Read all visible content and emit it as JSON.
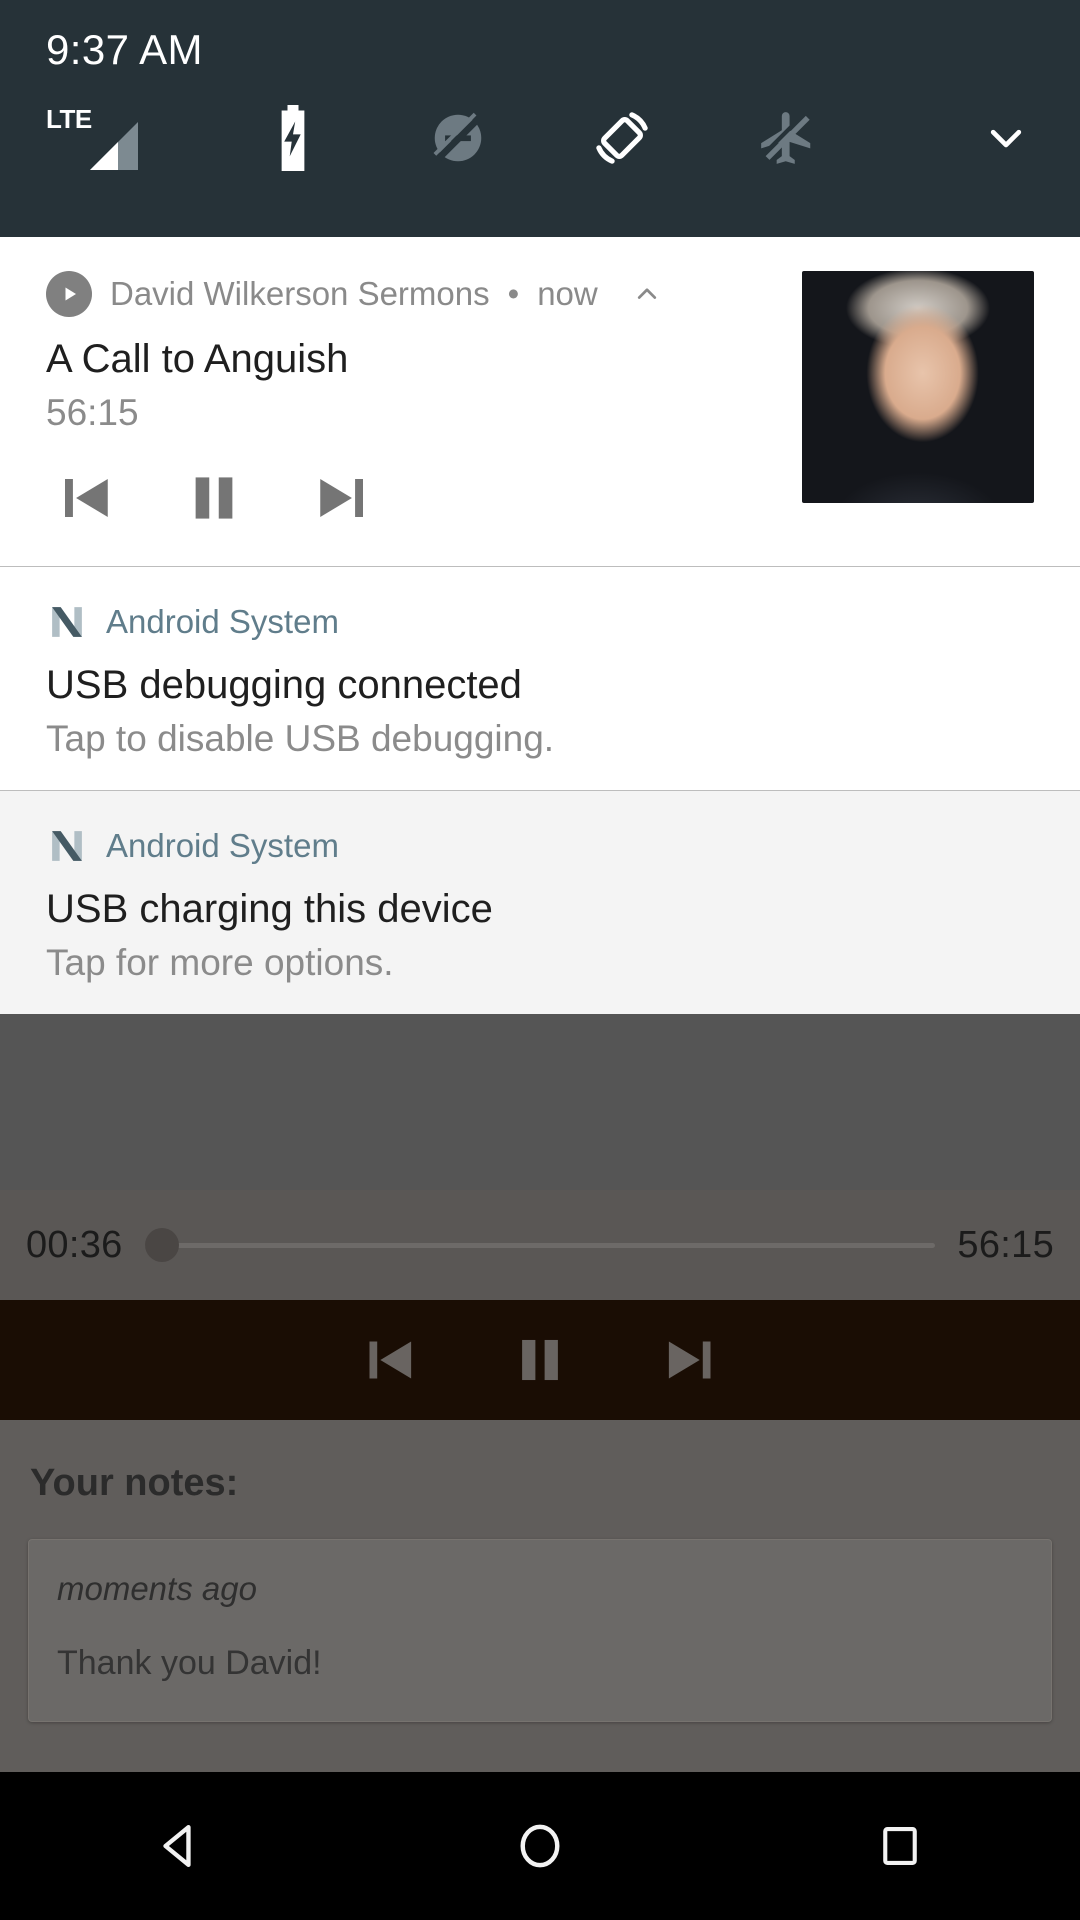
{
  "status_bar": {
    "clock": "9:37 AM",
    "icons": [
      {
        "name": "lte-signal-icon",
        "label": "LTE"
      },
      {
        "name": "battery-charging-icon",
        "label": ""
      },
      {
        "name": "do-not-disturb-off-icon",
        "label": ""
      },
      {
        "name": "auto-rotate-icon",
        "label": ""
      },
      {
        "name": "airplane-mode-off-icon",
        "label": ""
      },
      {
        "name": "chevron-down-icon",
        "label": ""
      }
    ],
    "background_color": "#263238"
  },
  "notifications": [
    {
      "type": "media",
      "app_name": "David Wilkerson Sermons",
      "separator": "•",
      "time": "now",
      "title": "A Call to Anguish",
      "subtitle": "56:15",
      "controls": [
        {
          "name": "previous-button",
          "label": "Previous"
        },
        {
          "name": "pause-button",
          "label": "Pause"
        },
        {
          "name": "next-button",
          "label": "Next"
        }
      ],
      "artwork_alt": "David Wilkerson portrait"
    },
    {
      "type": "system",
      "app_name": "Android System",
      "title": "USB debugging connected",
      "subtitle": "Tap to disable USB debugging."
    },
    {
      "type": "system",
      "app_name": "Android System",
      "title": "USB charging this device",
      "subtitle": "Tap for more options."
    }
  ],
  "player": {
    "elapsed": "00:36",
    "duration": "56:15",
    "progress_percent": 1,
    "controls": [
      {
        "name": "previous-button",
        "label": "Previous"
      },
      {
        "name": "pause-button",
        "label": "Pause"
      },
      {
        "name": "next-button",
        "label": "Next"
      }
    ]
  },
  "notes": {
    "heading": "Your notes:",
    "items": [
      {
        "timestamp": "moments ago",
        "text": "Thank you David!"
      }
    ]
  },
  "nav_bar": {
    "back": "Back",
    "home": "Home",
    "recents": "Recent apps"
  },
  "colors": {
    "status_bar": "#263238",
    "system_app_accent": "#607d8b",
    "notification_bg": "#ffffff",
    "notification_alt_bg": "#f4f4f4",
    "nav_bar": "#000000"
  }
}
